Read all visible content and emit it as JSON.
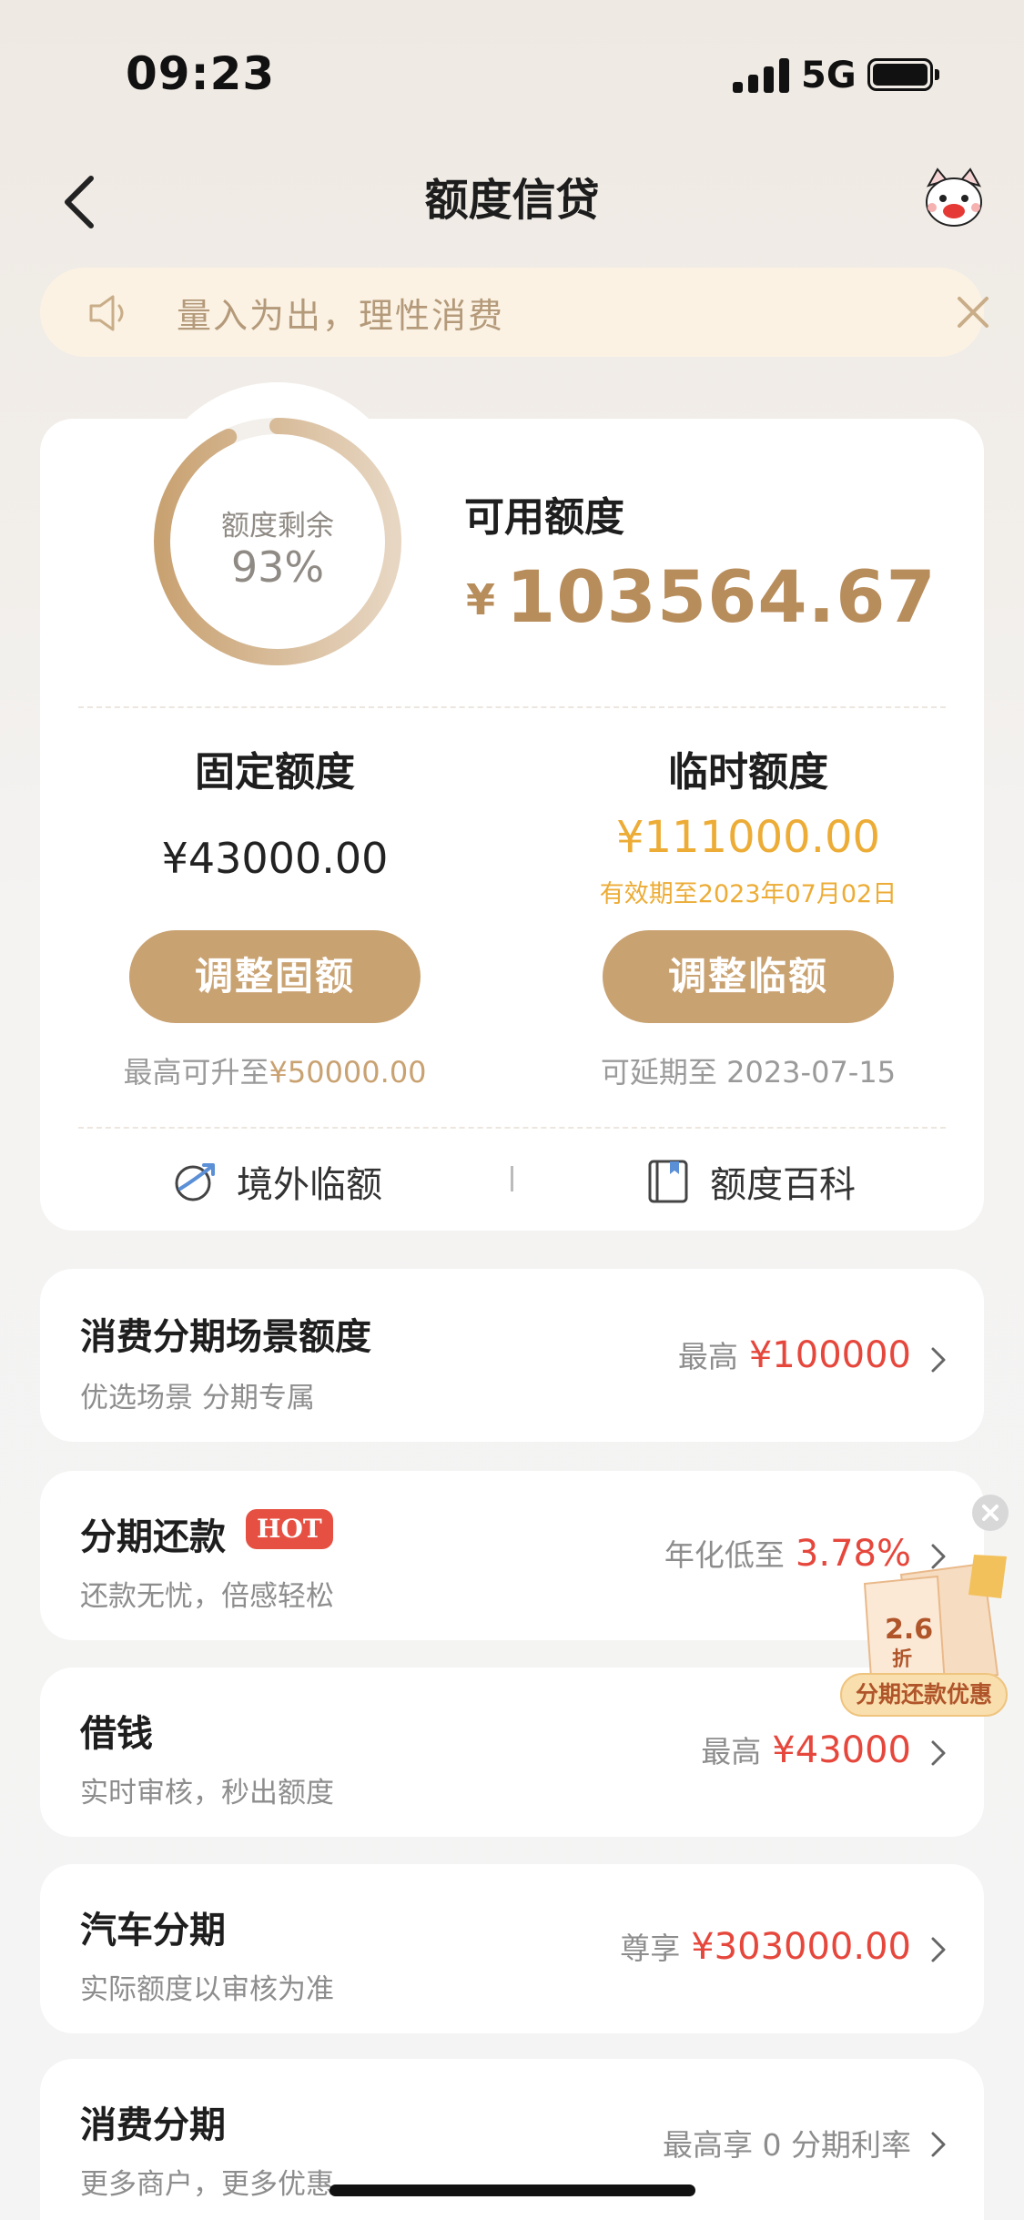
{
  "status_bar": {
    "time": "09:23",
    "network": "5G"
  },
  "header": {
    "title": "额度信贷"
  },
  "notice": {
    "text": "量入为出，理性消费"
  },
  "credit": {
    "ring_label": "额度剩余",
    "ring_percent": "93%",
    "ring_fraction": 0.93,
    "available_label": "可用额度",
    "available_currency": "¥",
    "available_amount": "103564.67",
    "fixed": {
      "title": "固定额度",
      "amount": "¥43000.00",
      "button": "调整固额",
      "note_prefix": "最高可升至",
      "note_value": "¥50000.00"
    },
    "temporary": {
      "title": "临时额度",
      "amount": "¥111000.00",
      "valid": "有效期至2023年07月02日",
      "button": "调整临额",
      "note": "可延期至 2023-07-15"
    },
    "links": [
      {
        "label": "境外临额"
      },
      {
        "label": "额度百科"
      }
    ]
  },
  "rows": [
    {
      "title": "消费分期场景额度",
      "subtitle": "优选场景 分期专属",
      "right_prefix": "最高",
      "right_value": "¥100000"
    },
    {
      "title": "分期还款",
      "badge": "HOT",
      "subtitle": "还款无忧，倍感轻松",
      "right_prefix": "年化低至",
      "right_value": "3.78%"
    },
    {
      "title": "借钱",
      "subtitle": "实时审核，秒出额度",
      "right_prefix": "最高",
      "right_value": "¥43000"
    },
    {
      "title": "汽车分期",
      "subtitle": "实际额度以审核为准",
      "right_prefix": "尊享",
      "right_value": "¥303000.00"
    },
    {
      "title": "消费分期",
      "subtitle": "更多商户，更多优惠",
      "right_prefix": "最高享 0 分期利率",
      "right_value": ""
    }
  ],
  "promo": {
    "discount": "2.6",
    "discount_unit": "折",
    "label": "分期还款优惠"
  },
  "colors": {
    "accent": "#c9a272",
    "gold_text": "#b88d5c",
    "temp_yellow": "#ecac36",
    "red": "#e6473c"
  }
}
